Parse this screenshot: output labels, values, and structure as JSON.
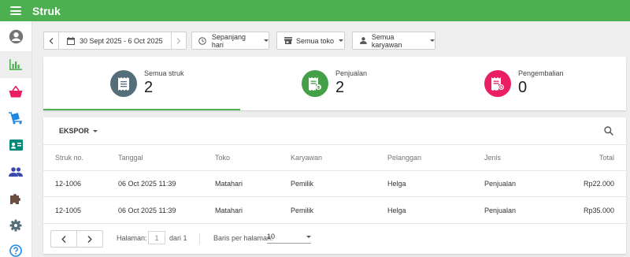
{
  "app": {
    "title": "Struk"
  },
  "filters": {
    "date_range": "30 Sept 2025 - 6 Oct 2025",
    "time": "Sepanjang hari",
    "store": "Semua toko",
    "employee": "Semua karyawan"
  },
  "summary": [
    {
      "label": "Semua struk",
      "value": "2",
      "color": "#546e7a",
      "icon": "receipt-icon"
    },
    {
      "label": "Penjualan",
      "value": "2",
      "color": "#43a047",
      "icon": "sales-receipt-icon"
    },
    {
      "label": "Pengembalian",
      "value": "0",
      "color": "#e91e63",
      "icon": "refund-receipt-icon"
    }
  ],
  "table": {
    "export_label": "EKSPOR",
    "columns": [
      "Struk no.",
      "Tanggal",
      "Toko",
      "Karyawan",
      "Pelanggan",
      "Jenis",
      "Total"
    ],
    "rows": [
      [
        "12-1006",
        "06 Oct 2025 11:39",
        "Matahari",
        "Pemilik",
        "Helga",
        "Penjualan",
        "Rp22.000"
      ],
      [
        "12-1005",
        "06 Oct 2025 11:39",
        "Matahari",
        "Pemilik",
        "Helga",
        "Penjualan",
        "Rp35.000"
      ]
    ]
  },
  "pagination": {
    "page_label": "Halaman:",
    "page": "1",
    "of_label": "dari 1",
    "rows_label": "Baris per halaman:",
    "rows_per_page": "10"
  },
  "sidebar_icons": [
    "account-icon",
    "reports-icon",
    "items-icon",
    "inventory-icon",
    "employees-icon",
    "customers-icon",
    "integrations-icon",
    "settings-icon",
    "help-icon"
  ],
  "colors": {
    "accent": "#4caf50"
  }
}
